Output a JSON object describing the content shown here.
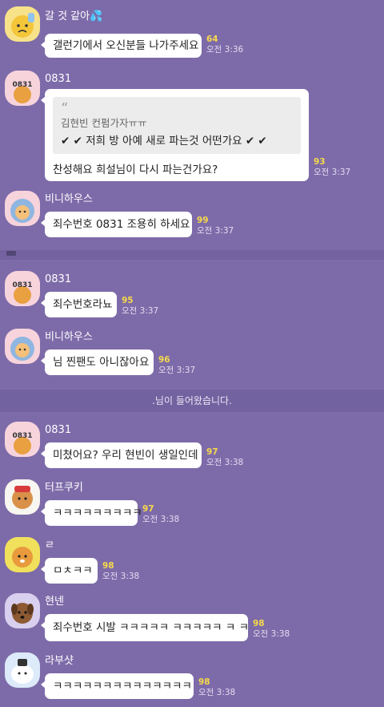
{
  "messages": [
    {
      "sender": "갈 것 같아💦",
      "avatar": "sad-character-avatar-icon",
      "text": "갤런기에서 오신분들 나가주세요",
      "count": "64",
      "time": "오전 3:36"
    },
    {
      "sender": "0831",
      "avatar": "0831-character-avatar-icon",
      "quote_name": "김현빈 컨펌가자ㅠㅠ",
      "quote_text": "✔ ✔ 저희 방 아예 새로 파는것 어떤가요 ✔ ✔",
      "text": "찬성해요 희설님이 다시 파는건가요?",
      "count": "93",
      "time": "오전 3:37"
    },
    {
      "sender": "비니하우스",
      "avatar": "hooded-character-avatar-icon",
      "text": "죄수번호 0831 조용히 하세요",
      "count": "99",
      "time": "오전 3:37"
    },
    {
      "sender": "0831",
      "avatar": "0831-character-avatar-icon",
      "text": "죄수번호라뇨",
      "count": "95",
      "time": "오전 3:37"
    },
    {
      "sender": "비니하우스",
      "avatar": "hooded-character-avatar-icon",
      "text": "님 찐팬도 아니잖아요",
      "count": "96",
      "time": "오전 3:37"
    },
    {
      "sender": "0831",
      "avatar": "0831-character-avatar-icon",
      "text": "미쳤어요? 우리 현빈이 생일인데",
      "count": "97",
      "time": "오전 3:38"
    },
    {
      "sender": "터프쿠키",
      "avatar": "cookie-character-avatar-icon",
      "text": "ㅋㅋㅋㅋㅋㅋㅋㅋㅋ",
      "count": "97",
      "time": "오전 3:38"
    },
    {
      "sender": "ㄹ",
      "avatar": "lion-character-avatar-icon",
      "text": "ㅁㅊㅋㅋ",
      "count": "98",
      "time": "오전 3:38"
    },
    {
      "sender": "현넨",
      "avatar": "dog-character-avatar-icon",
      "text": "죄수번호 시발 ㅋㅋㅋㅋㅋ ㅋㅋㅋㅋㅋ ㅋ ㅋ",
      "count": "98",
      "time": "오전 3:38"
    },
    {
      "sender": "라부샷",
      "avatar": "white-character-avatar-icon",
      "text": "ㅋㅋㅋㅋㅋㅋㅋㅋㅋㅋㅋㅋㅋㅋ",
      "count": "98",
      "time": "오전 3:38"
    }
  ],
  "system_message": ".님이 들어왔습니다.",
  "colors": {
    "background": "#7d6ba9",
    "bubble": "#ffffff",
    "unread_count": "#f6d94a"
  }
}
